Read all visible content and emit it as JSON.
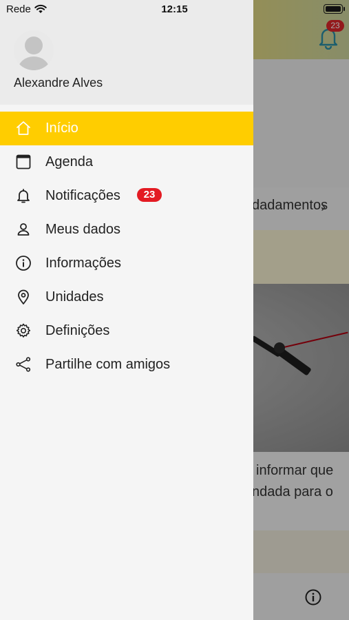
{
  "status_bar": {
    "carrier": "Rede",
    "time": "12:15"
  },
  "background": {
    "bell_badge": "23",
    "row_text": "dadamentos",
    "text_line1": "informar que",
    "text_line2": "ndada para o"
  },
  "drawer": {
    "user_name": "Alexandre Alves",
    "items": [
      {
        "label": "Início",
        "icon": "home-icon",
        "active": true
      },
      {
        "label": "Agenda",
        "icon": "calendar-icon"
      },
      {
        "label": "Notificações",
        "icon": "bell-icon",
        "badge": "23"
      },
      {
        "label": "Meus dados",
        "icon": "person-icon"
      },
      {
        "label": "Informações",
        "icon": "info-icon"
      },
      {
        "label": "Unidades",
        "icon": "location-pin-icon"
      },
      {
        "label": "Definições",
        "icon": "gear-icon"
      },
      {
        "label": "Partilhe com amigos",
        "icon": "share-icon"
      }
    ]
  },
  "colors": {
    "accent": "#ffcd00",
    "badge": "#e31b23"
  }
}
